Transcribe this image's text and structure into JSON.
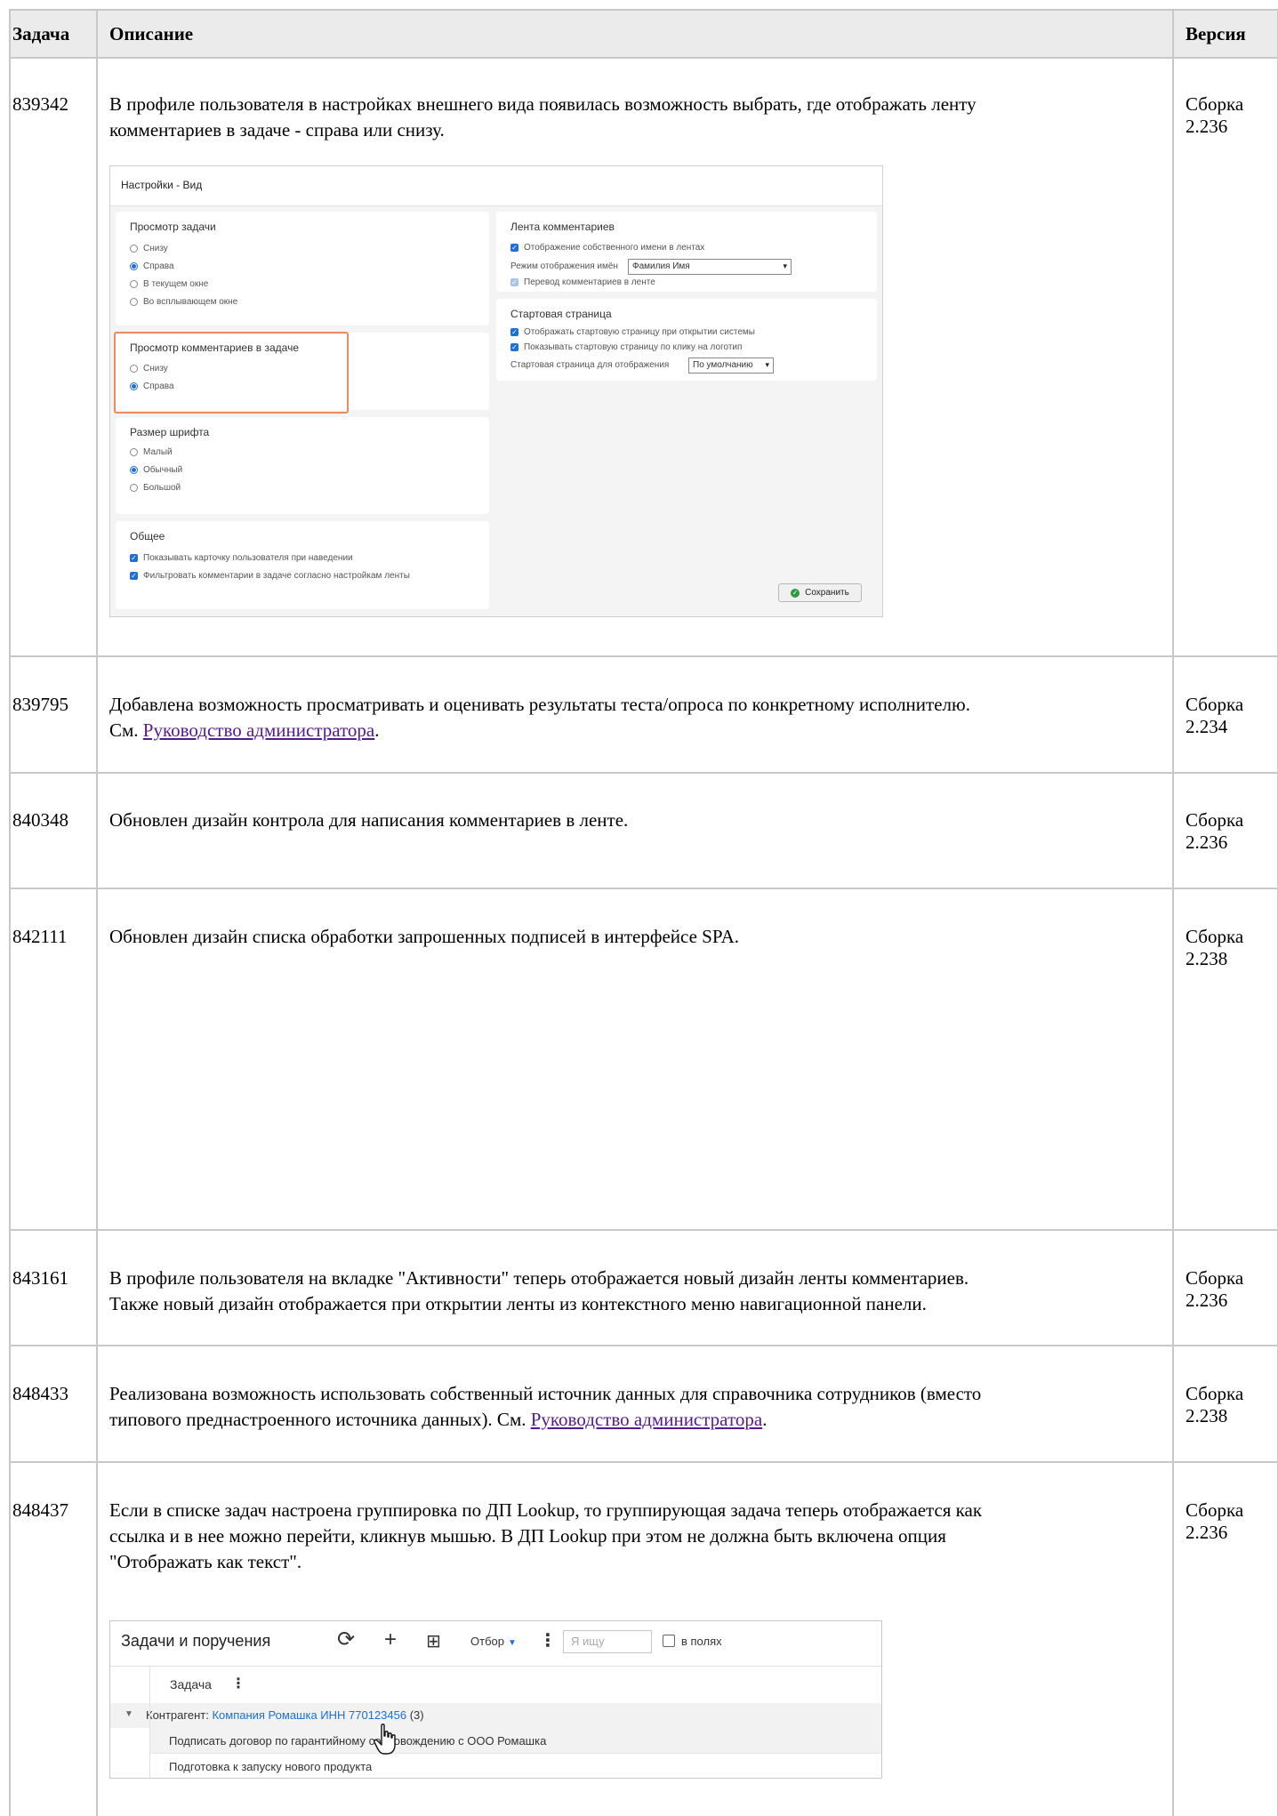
{
  "header": {
    "task": "Задача",
    "description": "Описание",
    "version": "Версия"
  },
  "rows": [
    {
      "id": "839342",
      "lines": [
        "В профиле пользователя в настройках внешнего вида появилась возможность выбрать, где отображать ленту",
        "комментариев в задаче - справа или снизу."
      ],
      "version_1": "Сборка",
      "version_2": "2.236"
    },
    {
      "id": "839795",
      "line1": "Добавлена возможность просматривать и оценивать результаты теста/опроса по конкретному исполнителю.",
      "line2_prefix": "См. ",
      "link": "Руководство администратора",
      "line2_suffix": ".",
      "version_1": "Сборка",
      "version_2": "2.234"
    },
    {
      "id": "840348",
      "text": "Обновлен дизайн контрола для написания комментариев в ленте.",
      "version_1": "Сборка",
      "version_2": "2.236"
    },
    {
      "id": "842111",
      "text": "Обновлен дизайн списка обработки запрошенных подписей в интерфейсе SPA.",
      "version_1": "Сборка",
      "version_2": "2.238"
    },
    {
      "id": "843161",
      "lines": [
        "В профиле пользователя на вкладке \"Активности\" теперь отображается новый дизайн ленты комментариев.",
        "Также новый дизайн  отображается при открытии ленты из контекстного меню навигационной панели."
      ],
      "version_1": "Сборка",
      "version_2": "2.236"
    },
    {
      "id": "848433",
      "line1": "Реализована возможность использовать собственный источник данных для справочника сотрудников (вместо",
      "line2_prefix": "типового преднастроенного источника данных). См. ",
      "link": "Руководство администратора",
      "line2_suffix": ".",
      "version_1": "Сборка",
      "version_2": "2.238"
    },
    {
      "id": "848437",
      "lines": [
        "Если в списке задач настроена группировка по ДП Lookup, то группирующая задача теперь отображается как",
        "ссылка и в нее можно перейти, кликнув мышью. В ДП Lookup при этом не должна быть включена опция",
        "\"Отображать как текст\"."
      ],
      "version_1": "Сборка",
      "version_2": "2.236"
    }
  ],
  "settings_shot": {
    "title": "Настройки - Вид",
    "task_view": {
      "title": "Просмотр задачи",
      "options": [
        "Снизу",
        "Справа",
        "В текущем окне",
        "Во всплывающем окне"
      ]
    },
    "comments_view": {
      "title": "Просмотр комментариев в задаче",
      "options": [
        "Снизу",
        "Справа"
      ]
    },
    "font_size": {
      "title": "Размер шрифта",
      "options": [
        "Малый",
        "Обычный",
        "Большой"
      ]
    },
    "general": {
      "title": "Общее",
      "options": [
        "Показывать карточку пользователя при наведении",
        "Фильтровать комментарии в задаче согласно настройкам ленты"
      ]
    },
    "feed": {
      "title": "Лента комментариев",
      "own_name": "Отображение собственного имени в лентах",
      "name_mode_label": "Режим отображения имён",
      "name_mode_value": "Фамилия Имя",
      "translate": "Перевод комментариев в ленте"
    },
    "start_page": {
      "title": "Стартовая страница",
      "opt1": "Отображать стартовую страницу при открытии системы",
      "opt2": "Показывать стартовую страницу по клику на логотип",
      "page_label": "Стартовая страница для отображения",
      "page_value": "По умолчанию"
    },
    "save": "Сохранить"
  },
  "tasks_shot": {
    "title": "Задачи и поручения",
    "filter": "Отбор",
    "search_placeholder": "Я ищу",
    "in_fields": "в полях",
    "column": "Задача",
    "group_prefix": "Контрагент: ",
    "group_link": "Компания Ромашка ИНН 770123456",
    "group_count": " (3)",
    "tasks": [
      "Подписать договор по гарантийному сопровождению с ООО Ромашка",
      "Подготовка к запуску нового продукта"
    ]
  }
}
